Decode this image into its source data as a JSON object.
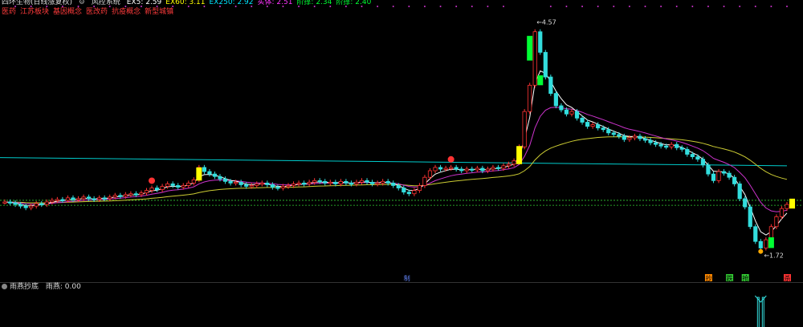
{
  "header": {
    "indicator_name": "四环生物(日线涨复权)",
    "system_name": "风控系统",
    "ma_values": [
      {
        "label": "EX5: 2.59",
        "color": "#ffffff"
      },
      {
        "label": "EX60: 3.11",
        "color": "#ffff00"
      },
      {
        "label": "EX250: 2.92",
        "color": "#00e5ff"
      },
      {
        "label": "实体: 2.51",
        "color": "#ff33ff"
      },
      {
        "label": "阶撑: 2.34",
        "color": "#00ff33"
      },
      {
        "label": "阶撑: 2.40",
        "color": "#00ff33"
      }
    ],
    "concepts": [
      "医药",
      "江苏板块",
      "基因概念",
      "医改药",
      "抗疫概念",
      "新型城镇"
    ]
  },
  "sub_header": {
    "name": "雨燕抄底",
    "value_label": "雨燕: 0.00"
  },
  "annotations": {
    "high": "←4.57",
    "low": "←1.72",
    "bottom_tags": [
      "抄",
      "跌",
      "抢",
      "杀"
    ],
    "mid_tag": "制"
  },
  "colors": {
    "up": "#ff3333",
    "down": "#33dddd",
    "ma5": "#ffffff",
    "ma_slow": "#cc33cc",
    "ma60": "#cccc33",
    "ma250": "#00cccc",
    "support": "#33cc33",
    "signal_yellow": "#ffff00",
    "signal_green": "#00ff33"
  },
  "chart_data": {
    "type": "candlestick",
    "ylim": [
      1.6,
      4.7
    ],
    "price_high": 4.57,
    "price_low": 1.72,
    "support_levels": [
      2.34,
      2.4
    ],
    "ma250_start": 2.92,
    "ma250_end": 2.82,
    "closes": [
      2.38,
      2.37,
      2.35,
      2.33,
      2.31,
      2.33,
      2.36,
      2.35,
      2.38,
      2.4,
      2.41,
      2.4,
      2.43,
      2.41,
      2.42,
      2.44,
      2.42,
      2.41,
      2.43,
      2.42,
      2.44,
      2.46,
      2.45,
      2.47,
      2.48,
      2.47,
      2.49,
      2.52,
      2.55,
      2.53,
      2.57,
      2.6,
      2.58,
      2.56,
      2.58,
      2.61,
      2.65,
      2.8,
      2.75,
      2.72,
      2.69,
      2.66,
      2.63,
      2.61,
      2.62,
      2.59,
      2.57,
      2.58,
      2.6,
      2.61,
      2.59,
      2.56,
      2.55,
      2.57,
      2.58,
      2.6,
      2.61,
      2.6,
      2.62,
      2.64,
      2.63,
      2.61,
      2.62,
      2.6,
      2.63,
      2.61,
      2.6,
      2.62,
      2.64,
      2.62,
      2.6,
      2.61,
      2.63,
      2.61,
      2.58,
      2.55,
      2.5,
      2.48,
      2.52,
      2.58,
      2.68,
      2.76,
      2.8,
      2.78,
      2.79,
      2.8,
      2.78,
      2.76,
      2.78,
      2.77,
      2.79,
      2.76,
      2.78,
      2.8,
      2.79,
      2.82,
      2.84,
      2.88,
      3.05,
      3.48,
      3.8,
      4.45,
      4.2,
      3.9,
      3.7,
      3.55,
      3.5,
      3.45,
      3.48,
      3.4,
      3.35,
      3.3,
      3.32,
      3.28,
      3.26,
      3.22,
      3.2,
      3.18,
      3.14,
      3.16,
      3.18,
      3.15,
      3.13,
      3.1,
      3.08,
      3.06,
      3.05,
      3.08,
      3.04,
      3.02,
      2.96,
      2.93,
      2.9,
      2.83,
      2.72,
      2.64,
      2.75,
      2.73,
      2.68,
      2.6,
      2.42,
      2.32,
      2.08,
      1.9,
      1.82,
      1.92,
      2.08,
      2.2,
      2.3,
      2.35
    ],
    "signals": [
      {
        "index": 37,
        "type": "yellow",
        "low": 2.64,
        "high": 2.8
      },
      {
        "index": 98,
        "type": "yellow",
        "low": 2.84,
        "high": 3.06
      },
      {
        "index": 100,
        "type": "green",
        "low": 4.1,
        "high": 4.4
      },
      {
        "index": 102,
        "type": "green",
        "low": 3.8,
        "high": 3.92
      },
      {
        "index": 146,
        "type": "green",
        "low": 1.82,
        "high": 1.95
      },
      {
        "index": 150,
        "type": "yellow",
        "low": 2.3,
        "high": 2.42
      }
    ]
  }
}
